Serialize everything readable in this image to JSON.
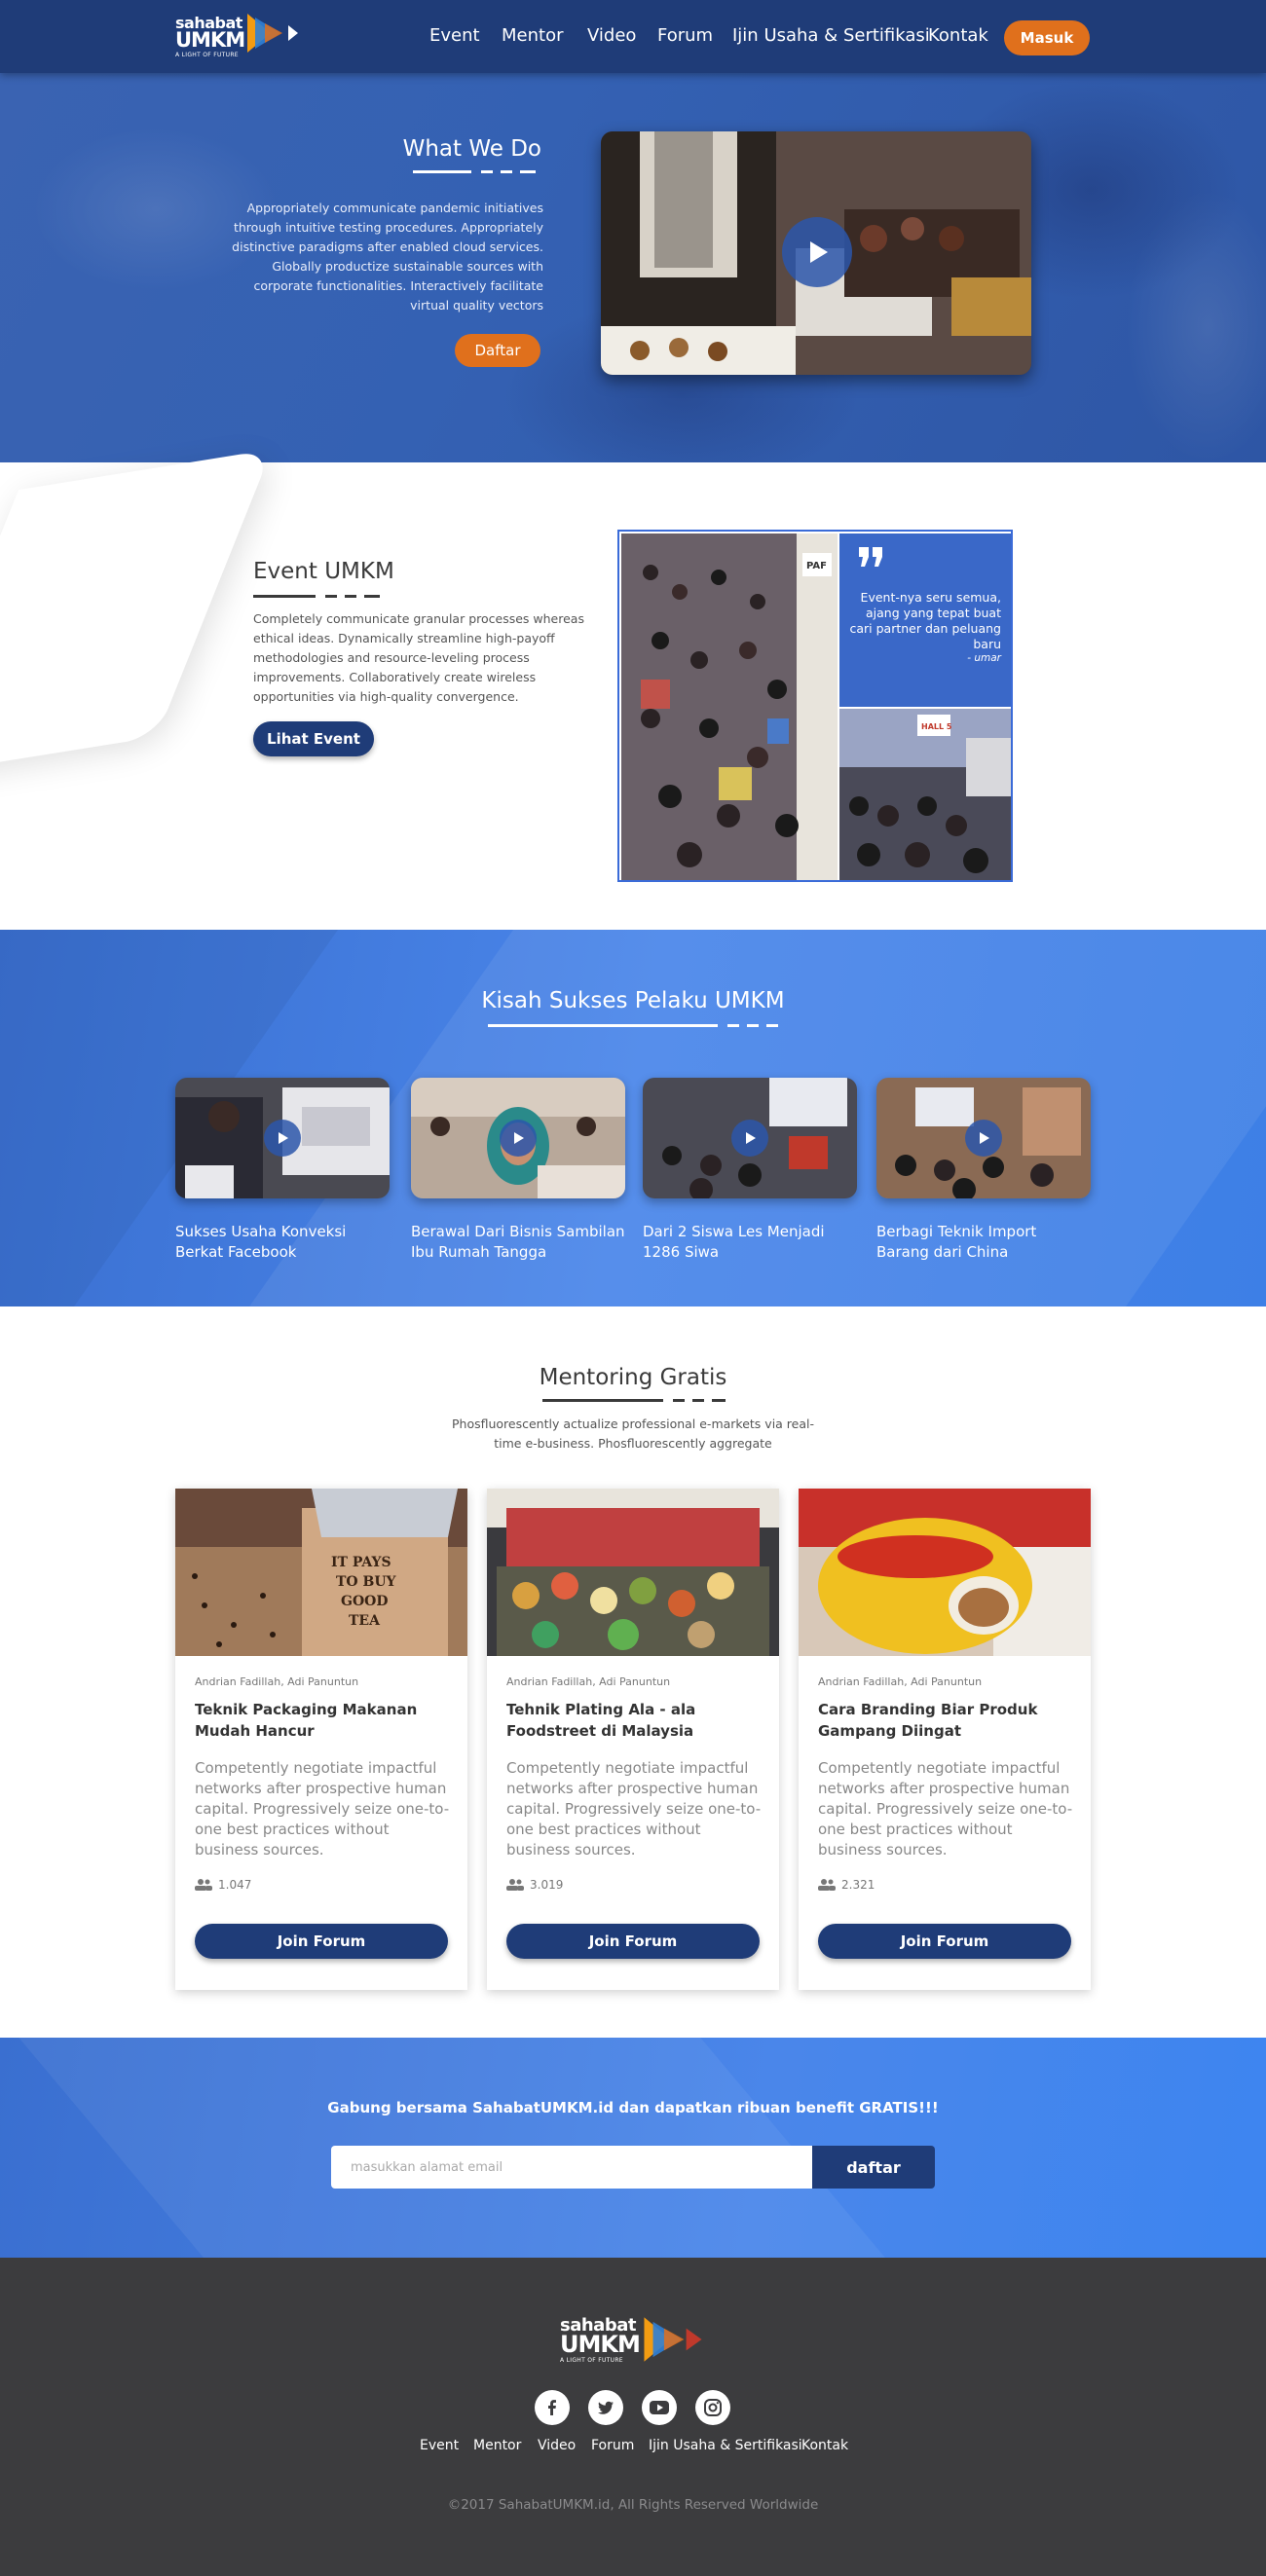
{
  "brand": {
    "line1": "sahabat",
    "line2": "UMKM",
    "tagline": "A LIGHT OF FUTURE"
  },
  "colors": {
    "navy": "#1f3c78",
    "orange": "#e0701c",
    "blue": "#3a6fd0",
    "footer": "#3c3c3e"
  },
  "nav": {
    "items": [
      "Event",
      "Mentor",
      "Video",
      "Forum",
      "Ijin Usaha & Sertifikasi",
      "Kontak"
    ],
    "login_label": "Masuk"
  },
  "hero": {
    "title": "What We Do",
    "text": "Appropriately communicate pandemic initiatives through intuitive testing procedures. Appropriately distinctive paradigms after enabled cloud services. Globally productize sustainable sources with corporate functionalities. Interactively facilitate virtual quality vectors",
    "button": "Daftar",
    "play_icon": "play-icon"
  },
  "event": {
    "title": "Event UMKM",
    "text": "Completely communicate granular processes whereas ethical ideas. Dynamically streamline high-payoff methodologies and resource-leveling process improvements. Collaboratively create wireless opportunities via high-quality convergence.",
    "button": "Lihat Event",
    "quote_icon": "quote-icon",
    "quote": "Event-nya seru semua, ajang yang tepat buat cari partner dan peluang baru",
    "quote_author": "- umar"
  },
  "kisah": {
    "title": "Kisah Sukses Pelaku UMKM",
    "cards": [
      {
        "caption": "Sukses Usaha Konveksi Berkat Facebook"
      },
      {
        "caption": "Berawal Dari Bisnis Sambilan Ibu Rumah Tangga"
      },
      {
        "caption": "Dari 2 Siswa Les Menjadi 1286 Siwa"
      },
      {
        "caption": "Berbagi Teknik Import Barang dari China"
      }
    ]
  },
  "mentoring": {
    "title": "Mentoring Gratis",
    "subtitle": "Phosfluorescently actualize professional e-markets via real-time e-business. Phosfluorescently aggregate",
    "cards": [
      {
        "author": "Andrian Fadillah, Adi Panuntun",
        "title": "Teknik Packaging Makanan Mudah Hancur",
        "desc": "Competently negotiate impactful networks after prospective human capital. Progressively seize one-to-one best practices without business sources.",
        "count": "1.047",
        "button": "Join Forum"
      },
      {
        "author": "Andrian Fadillah, Adi Panuntun",
        "title": "Tehnik Plating Ala - ala Foodstreet di Malaysia",
        "desc": "Competently negotiate impactful networks after prospective human capital. Progressively seize one-to-one best practices without business sources.",
        "count": "3.019",
        "button": "Join Forum"
      },
      {
        "author": "Andrian Fadillah, Adi Panuntun",
        "title": "Cara Branding Biar Produk Gampang Diingat",
        "desc": "Competently negotiate impactful networks after prospective human capital. Progressively seize one-to-one best practices without business sources.",
        "count": "2.321",
        "button": "Join Forum"
      }
    ],
    "box_text": "IT PAYS TO BUY GOOD TEA"
  },
  "newsletter": {
    "text": "Gabung bersama SahabatUMKM.id dan dapatkan ribuan benefit GRATIS!!!",
    "placeholder": "masukkan alamat email",
    "button": "daftar"
  },
  "footer": {
    "social": [
      "facebook-icon",
      "twitter-icon",
      "youtube-icon",
      "instagram-icon"
    ],
    "nav": [
      "Event",
      "Mentor",
      "Video",
      "Forum",
      "Ijin Usaha & Sertifikasi",
      "Kontak"
    ],
    "copyright": "©2017 SahabatUMKM.id, All Rights Reserved Worldwide"
  }
}
